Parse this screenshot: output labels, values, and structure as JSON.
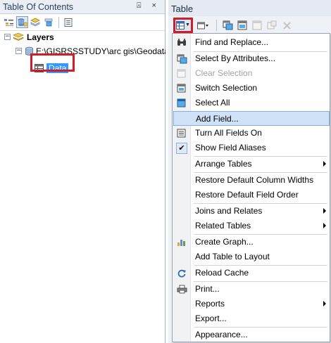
{
  "toc": {
    "title": "Table Of Contents",
    "pin_glyph": "⍓ ×",
    "layers_label": "Layers",
    "workspace_path": "E:\\GISRSSSTUDY\\arc gis\\Geodata",
    "table_label": "Data"
  },
  "table_window": {
    "title": "Table"
  },
  "menu": {
    "items": [
      {
        "label": "Find and Replace...",
        "icon": "binoculars-icon"
      },
      {
        "label": "Select By Attributes...",
        "icon": "select-by-attributes-icon"
      },
      {
        "label": "Clear Selection",
        "icon": "clear-selection-icon",
        "disabled": true
      },
      {
        "label": "Switch Selection",
        "icon": "switch-selection-icon"
      },
      {
        "label": "Select All",
        "icon": "select-all-icon"
      },
      {
        "label": "Add Field...",
        "icon": "",
        "highlighted": true
      },
      {
        "label": "Turn All Fields On",
        "icon": "fields-on-icon"
      },
      {
        "label": "Show Field Aliases",
        "icon": "checkmark-icon",
        "checked": true
      },
      {
        "label": "Arrange Tables",
        "submenu": true
      },
      {
        "label": "Restore Default Column Widths"
      },
      {
        "label": "Restore Default Field Order"
      },
      {
        "label": "Joins and Relates",
        "submenu": true
      },
      {
        "label": "Related Tables",
        "submenu": true
      },
      {
        "label": "Create Graph...",
        "icon": "graph-icon"
      },
      {
        "label": "Add Table to Layout"
      },
      {
        "label": "Reload Cache",
        "icon": "reload-icon"
      },
      {
        "label": "Print...",
        "icon": "printer-icon"
      },
      {
        "label": "Reports",
        "submenu": true
      },
      {
        "label": "Export..."
      },
      {
        "label": "Appearance..."
      }
    ]
  },
  "colors": {
    "highlight_box": "#d11c2a",
    "selection_blue": "#3399ff",
    "hover_fill": "#cfe2f8"
  }
}
